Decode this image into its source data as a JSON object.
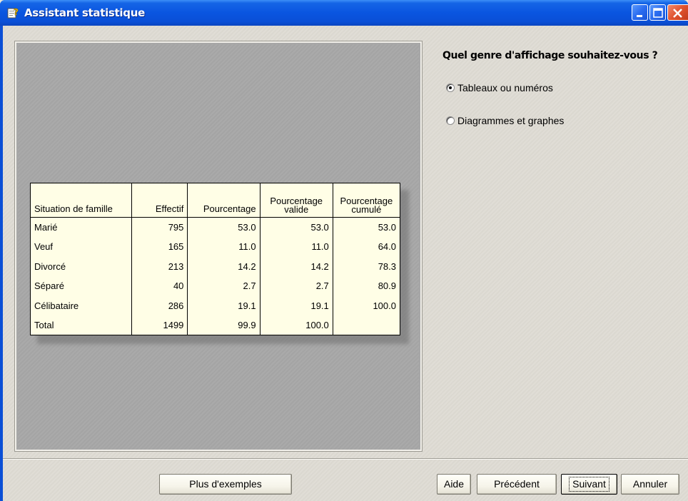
{
  "window": {
    "title": "Assistant statistique"
  },
  "preview": {
    "table": {
      "headers": {
        "label": "Situation de famille",
        "effectif": "Effectif",
        "pourcentage": "Pourcentage",
        "valide_line1": "Pourcentage",
        "valide_line2": "valide",
        "cumule_line1": "Pourcentage",
        "cumule_line2": "cumulé"
      },
      "rows": [
        {
          "label": "Marié",
          "effectif": "795",
          "pourcentage": "53.0",
          "valide": "53.0",
          "cumule": "53.0"
        },
        {
          "label": "Veuf",
          "effectif": "165",
          "pourcentage": "11.0",
          "valide": "11.0",
          "cumule": "64.0"
        },
        {
          "label": "Divorcé",
          "effectif": "213",
          "pourcentage": "14.2",
          "valide": "14.2",
          "cumule": "78.3"
        },
        {
          "label": "Séparé",
          "effectif": "40",
          "pourcentage": "2.7",
          "valide": "2.7",
          "cumule": "80.9"
        },
        {
          "label": "Célibataire",
          "effectif": "286",
          "pourcentage": "19.1",
          "valide": "19.1",
          "cumule": "100.0"
        },
        {
          "label": "Total",
          "effectif": "1499",
          "pourcentage": "99.9",
          "valide": "100.0",
          "cumule": ""
        }
      ]
    }
  },
  "options": {
    "question": "Quel genre d'affichage souhaitez-vous ?",
    "choices": [
      {
        "label": "Tableaux ou numéros",
        "selected": true
      },
      {
        "label": "Diagrammes et graphes",
        "selected": false
      }
    ]
  },
  "buttons": {
    "more_examples": "Plus d'exemples",
    "help": "Aide",
    "previous": "Précédent",
    "next": "Suivant",
    "cancel": "Annuler"
  },
  "colors": {
    "title_bar": "#0a4fd6",
    "table_background": "#fffee6",
    "preview_background": "#a7a7a7"
  },
  "icons": {
    "title": "wizard-icon",
    "minimize": "minimize-icon",
    "maximize": "maximize-icon",
    "close": "close-icon"
  }
}
